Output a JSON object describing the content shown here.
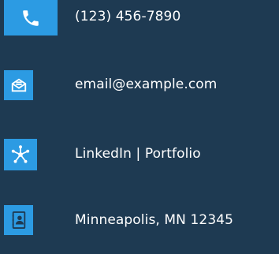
{
  "contacts": [
    {
      "icon": "phone-icon",
      "text": "(123) 456-7890"
    },
    {
      "icon": "envelope-icon",
      "text": "email@example.com"
    },
    {
      "icon": "network-icon",
      "text": "LinkedIn | Portfolio"
    },
    {
      "icon": "address-book-icon",
      "text": "Minneapolis, MN 12345"
    }
  ],
  "colors": {
    "background": "#1e3a52",
    "icon_background": "#2c9be3",
    "text": "#ffffff"
  }
}
